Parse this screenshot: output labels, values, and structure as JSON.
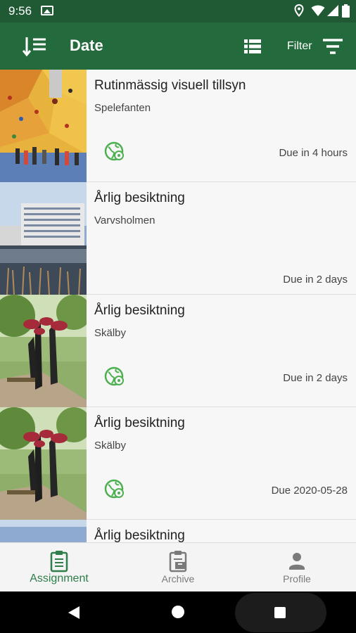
{
  "status_bar": {
    "time": "9:56"
  },
  "app_bar": {
    "title": "Date",
    "filter_label": "Filter"
  },
  "assignments": [
    {
      "title": "Rutinmässig visuell tillsyn",
      "location": "Spelefanten",
      "due": "Due in 4 hours",
      "has_globe": true
    },
    {
      "title": "Årlig besiktning",
      "location": "Varvsholmen",
      "due": "Due in 2 days",
      "has_globe": false
    },
    {
      "title": "Årlig besiktning",
      "location": "Skälby",
      "due": "Due in 2 days",
      "has_globe": true
    },
    {
      "title": "Årlig besiktning",
      "location": "Skälby",
      "due": "Due 2020-05-28",
      "has_globe": true
    },
    {
      "title": "Årlig besiktning",
      "location": "",
      "due": "",
      "has_globe": false
    }
  ],
  "bottom_nav": {
    "assignment": "Assignment",
    "archive": "Archive",
    "profile": "Profile"
  },
  "colors": {
    "primary": "#236b3d",
    "status_bar": "#1f5a34",
    "accent_green": "#4caf50",
    "active_nav": "#2e7d4b"
  },
  "icons": [
    "sort-icon",
    "list-view-icon",
    "filter-icon",
    "globe-location-icon",
    "clipboard-icon",
    "archive-icon",
    "person-icon"
  ]
}
